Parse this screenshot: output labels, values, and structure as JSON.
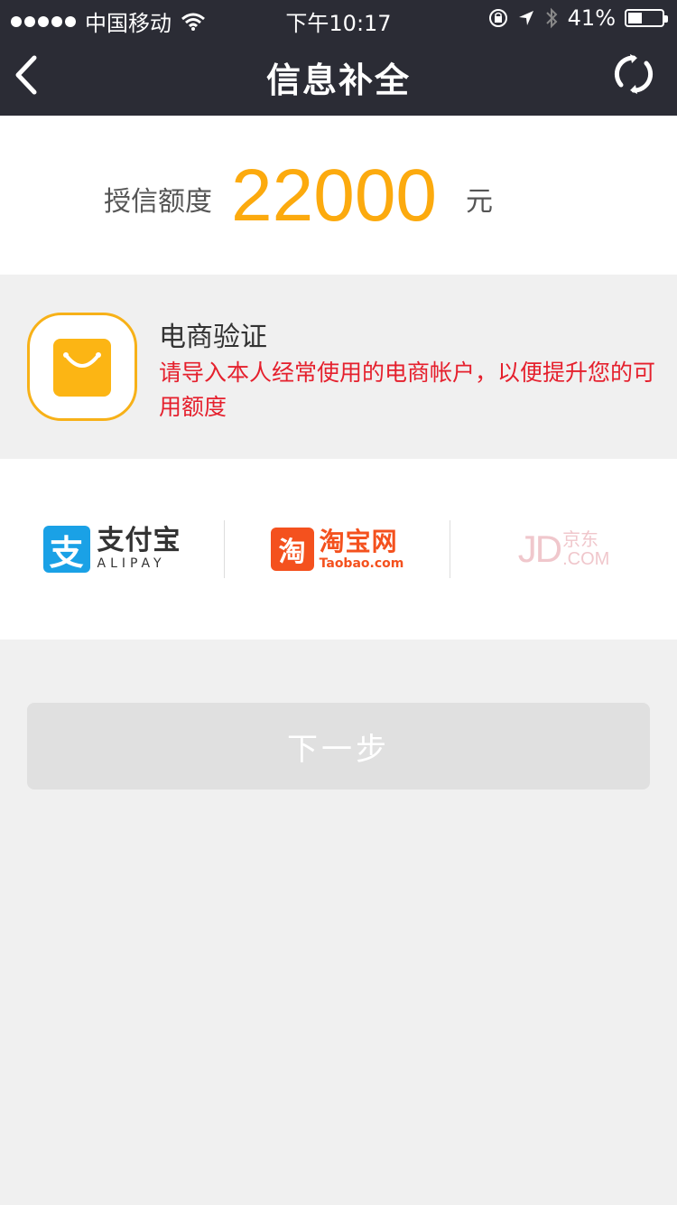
{
  "status_bar": {
    "carrier": "中国移动",
    "time": "下午10:17",
    "battery_text": "41%",
    "battery_level": 0.41
  },
  "header": {
    "title": "信息补全",
    "back_icon": "chevron-left-icon",
    "refresh_icon": "refresh-icon"
  },
  "credit": {
    "label": "授信额度",
    "amount": "22000",
    "unit": "元"
  },
  "ecommerce": {
    "title": "电商验证",
    "description": "请导入本人经常使用的电商帐户，以便提升您的可用额度"
  },
  "platforms": {
    "alipay": {
      "mark": "支",
      "name": "支付宝",
      "sub": "ALIPAY"
    },
    "taobao": {
      "mark": "淘",
      "name": "淘宝网",
      "sub": "Taobao.com"
    },
    "jd": {
      "big": "JD",
      "cn": "京东",
      "en": ".COM"
    }
  },
  "next_button": {
    "label": "下一步"
  },
  "colors": {
    "header_bg": "#2b2c35",
    "accent": "#fcaa0e",
    "warning": "#e5202d",
    "alipay_blue": "#1aa1e6",
    "taobao_orange": "#f4511e"
  }
}
